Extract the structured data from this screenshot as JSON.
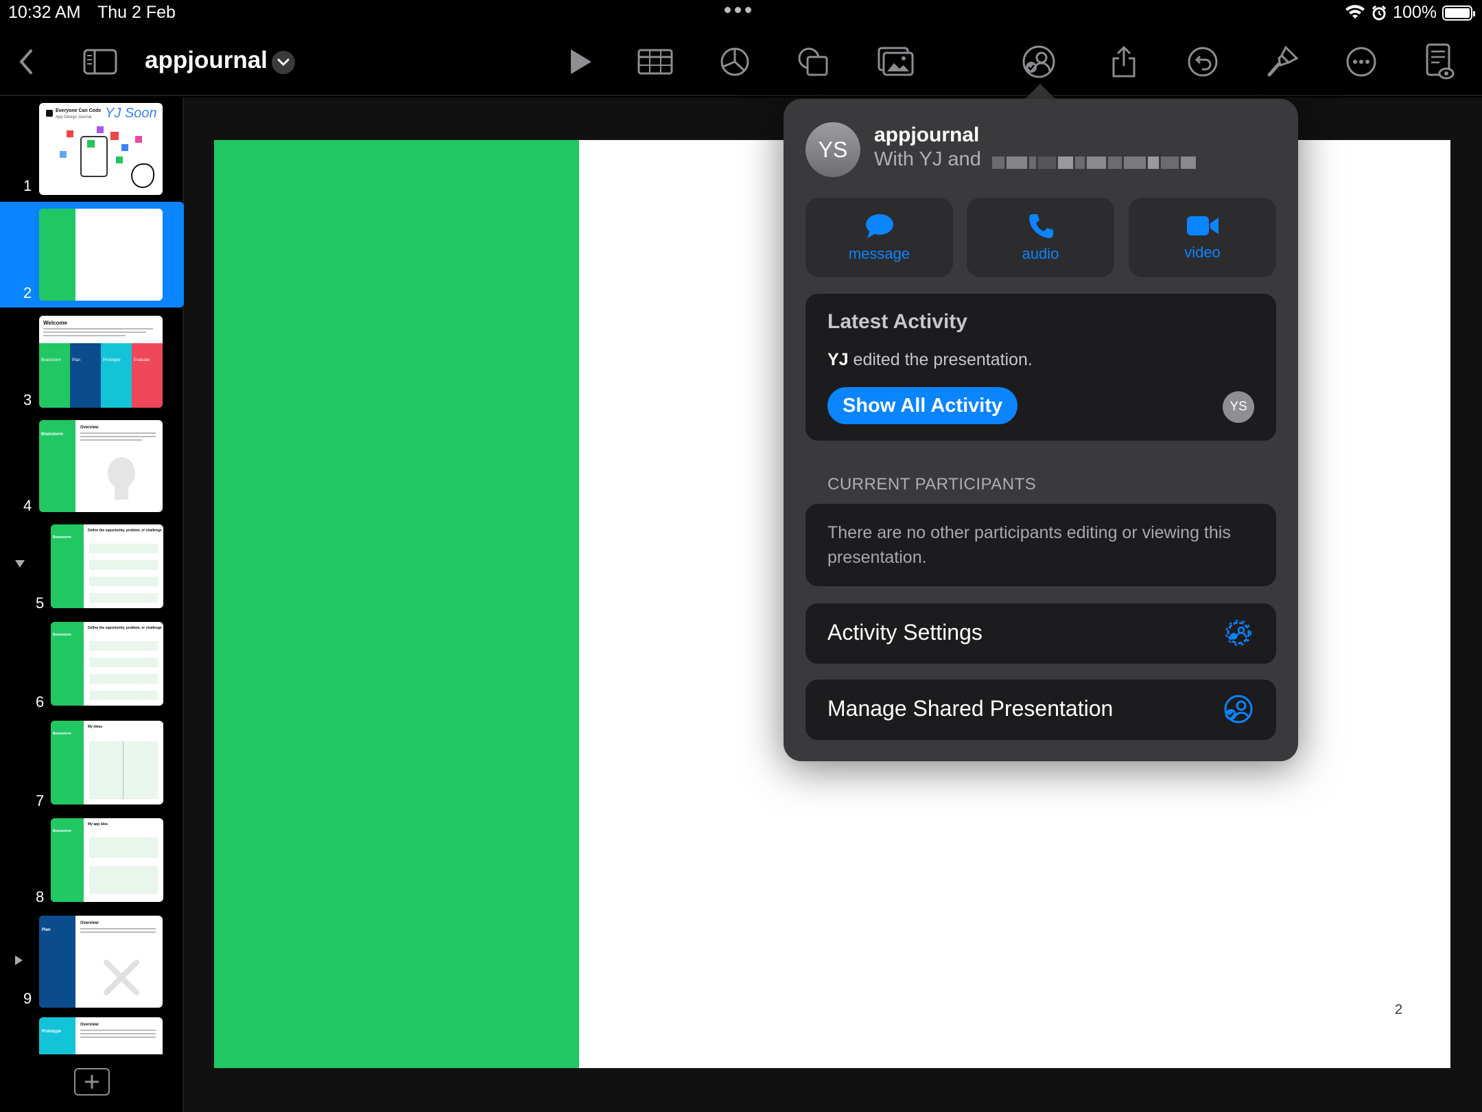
{
  "status": {
    "time": "10:32 AM",
    "date": "Thu 2 Feb",
    "battery": "100%",
    "battery_level": 1.0
  },
  "toolbar": {
    "doc_title": "appjournal",
    "icons": [
      "back-icon",
      "sidebar-icon",
      "chevron-down-icon",
      "play-icon",
      "table-icon",
      "chart-icon",
      "shape-icon",
      "media-icon",
      "collaboration-icon",
      "share-icon",
      "undo-icon",
      "format-brush-icon",
      "more-icon",
      "reader-icon"
    ]
  },
  "sidebar": {
    "slides": [
      {
        "number": "1",
        "title": "Everyone Can Code",
        "subtitle": "App Design Journal",
        "handwriting": "YJ Soon",
        "selected": false
      },
      {
        "number": "2",
        "selected": true
      },
      {
        "number": "3",
        "title": "Welcome",
        "sections": [
          "Brainstorm",
          "Plan",
          "Prototype",
          "Evaluate"
        ],
        "selected": false
      },
      {
        "number": "4",
        "title": "Overview",
        "section": "Brainstorm",
        "selected": false,
        "disclosure": "down"
      },
      {
        "number": "5",
        "title": "Define the opportunity, problem, or challenge",
        "section": "Brainstorm",
        "selected": false
      },
      {
        "number": "6",
        "title": "Define the opportunity, problem, or challenge",
        "section": "Brainstorm",
        "selected": false
      },
      {
        "number": "7",
        "title": "My ideas",
        "section": "Brainstorm",
        "selected": false
      },
      {
        "number": "8",
        "title": "My app idea",
        "section": "Brainstorm",
        "selected": false
      },
      {
        "number": "9",
        "title": "Overview",
        "section": "Plan",
        "selected": false,
        "disclosure": "right"
      },
      {
        "number": "",
        "title": "Overview",
        "section": "Prototype",
        "selected": false
      }
    ]
  },
  "slide": {
    "page_number": "2",
    "accent_color": "#21c763"
  },
  "popover": {
    "avatar_initials": "YS",
    "title": "appjournal",
    "subtitle": "With YJ and",
    "actions": [
      {
        "label": "message",
        "icon": "message-icon"
      },
      {
        "label": "audio",
        "icon": "phone-icon"
      },
      {
        "label": "video",
        "icon": "video-icon"
      }
    ],
    "latest": {
      "heading": "Latest Activity",
      "actor": "YJ",
      "action": "edited the presentation.",
      "button": "Show All Activity",
      "avatar": "YS"
    },
    "participants_header": "CURRENT PARTICIPANTS",
    "participants_text": "There are no other participants editing or viewing this presentation.",
    "activity_settings": "Activity Settings",
    "manage_shared": "Manage Shared Presentation"
  },
  "colors": {
    "accent": "#0a84ff",
    "slide_green": "#21c763",
    "plan_blue": "#0b4c8c",
    "prototype_cyan": "#13c4d8",
    "evaluate_red": "#f0465a"
  }
}
